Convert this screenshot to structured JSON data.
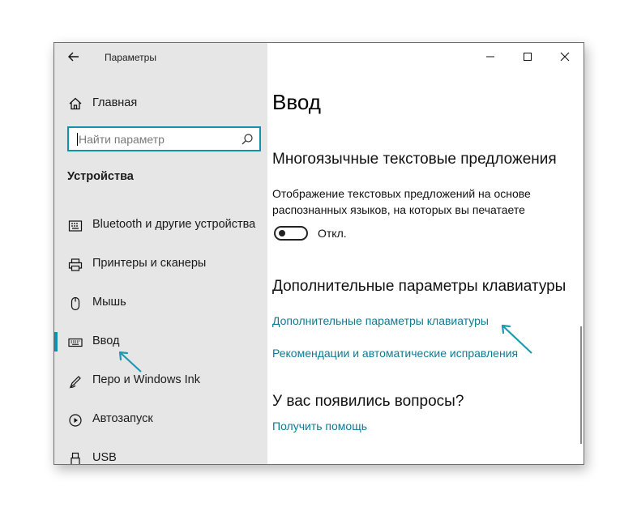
{
  "window": {
    "title": "Параметры"
  },
  "sidebar": {
    "home_label": "Главная",
    "search": {
      "placeholder": "Найти параметр"
    },
    "section_title": "Устройства",
    "items": [
      {
        "label": "Bluetooth и другие устройства",
        "icon": "bluetooth-devices-icon"
      },
      {
        "label": "Принтеры и сканеры",
        "icon": "printer-icon"
      },
      {
        "label": "Мышь",
        "icon": "mouse-icon"
      },
      {
        "label": "Ввод",
        "icon": "keyboard-icon",
        "selected": true
      },
      {
        "label": "Перо и Windows Ink",
        "icon": "pen-icon"
      },
      {
        "label": "Автозапуск",
        "icon": "autoplay-icon"
      },
      {
        "label": "USB",
        "icon": "usb-icon"
      }
    ]
  },
  "main": {
    "title": "Ввод",
    "multilingual": {
      "heading": "Многоязычные текстовые предложения",
      "description": "Отображение текстовых предложений на основе распознанных языков, на которых вы печатаете",
      "toggle_state": "Откл."
    },
    "keyboard": {
      "heading": "Дополнительные параметры клавиатуры",
      "link_advanced": "Дополнительные параметры клавиатуры",
      "link_recommendations": "Рекомендации и автоматические исправления"
    },
    "questions": {
      "heading": "У вас появились вопросы?",
      "link_help": "Получить помощь"
    }
  },
  "colors": {
    "accent": "#0f93ad",
    "link": "#0f7a93",
    "sidebar_bg": "#e6e6e6",
    "annotation_arrow": "#1a9bb0"
  }
}
